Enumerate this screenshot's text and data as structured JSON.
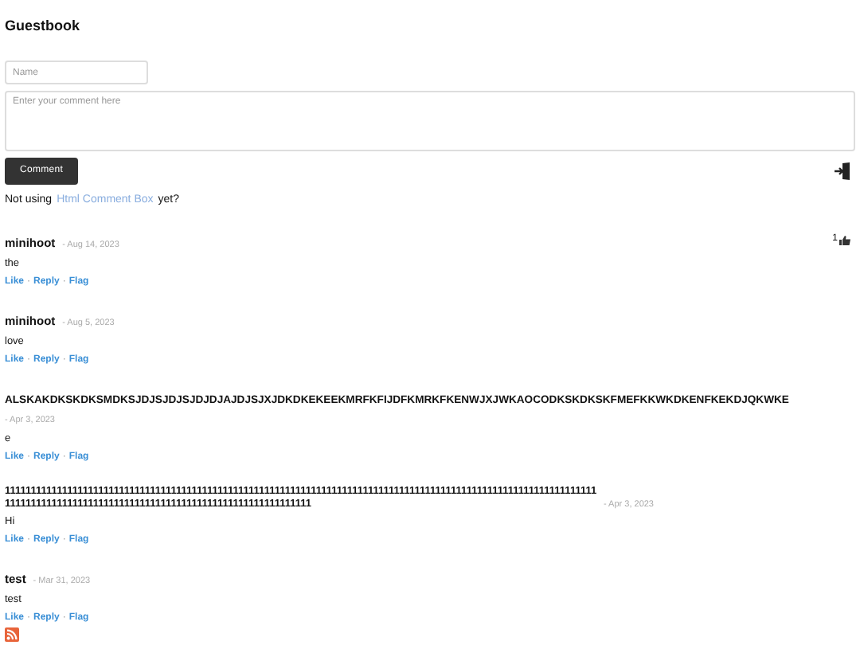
{
  "title": "Guestbook",
  "form": {
    "name_placeholder": "Name",
    "comment_placeholder": "Enter your comment here",
    "submit": "Comment"
  },
  "promo": {
    "before": "Not using",
    "link": "Html Comment Box",
    "after": "yet?"
  },
  "action_separator": "·",
  "comments": [
    {
      "author": "minihoot",
      "date": "- Aug 14, 2023",
      "text": "the",
      "likes": "1",
      "actions": [
        "Like",
        "Reply",
        "Flag"
      ]
    },
    {
      "author": "minihoot",
      "date": "- Aug 5, 2023",
      "text": "love",
      "actions": [
        "Like",
        "Reply",
        "Flag"
      ]
    },
    {
      "author": "ALSKAKDKSKDKSMDKSJDJSJDJSJDJDJAJDJSJXJDKDKEKEEKMRFKFIJDFKMRKFKENWJXJWKAOCODKSKDKSKFMEFKKWKDKENFKEKDJQKWKE",
      "date": "- Apr 3, 2023",
      "text": "e",
      "actions": [
        "Like",
        "Reply",
        "Flag"
      ]
    },
    {
      "author": "11111111111111111111111111111111111111111111111111111111111111111111111111111111111111111111111111111111111111111111111111111111111111111111111111111111111111111111111111111",
      "date": "- Apr 3, 2023",
      "text": "Hi",
      "actions": [
        "Like",
        "Reply",
        "Flag"
      ]
    },
    {
      "author": "test",
      "date": "- Mar 31, 2023",
      "text": "test",
      "actions": [
        "Like",
        "Reply",
        "Flag"
      ]
    }
  ]
}
